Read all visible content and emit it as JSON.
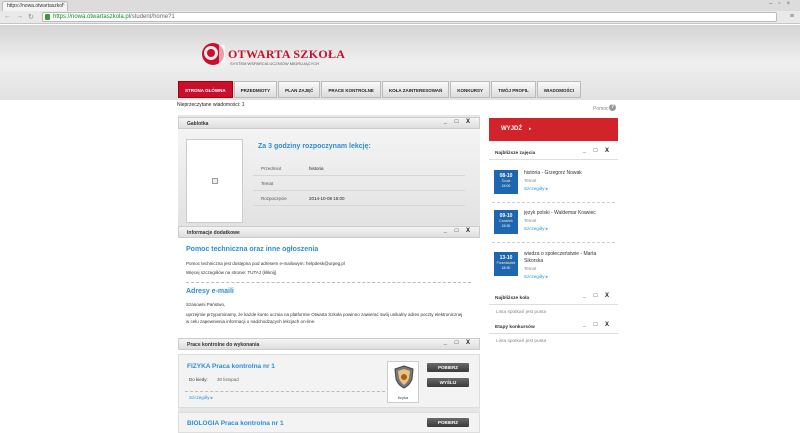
{
  "browser": {
    "tab_title": "https://nowa.otwartaszkol",
    "url_host": "https://nowa.otwartaszkola.pl",
    "url_path": "/student/home?1"
  },
  "logo": {
    "title": "OTWARTA SZKOŁA",
    "subtitle": "SYSTEM WSPARCIA UCZNIÓW MIGRUJĄCYCH"
  },
  "topnav": [
    {
      "label": "STRONA GŁÓWNA",
      "active": true
    },
    {
      "label": "PRZEDMIOTY"
    },
    {
      "label": "PLAN ZAJĘĆ"
    },
    {
      "label": "PRACE KONTROLNE"
    },
    {
      "label": "KOŁA ZAINTERESOWAŃ"
    },
    {
      "label": "KONKURSY"
    },
    {
      "label": "TWÓJ PROFIL"
    },
    {
      "label": "WIADOMOŚCI"
    }
  ],
  "unread_messages": "Nieprzeczytane wiadomości: 1",
  "help_label": "Pomoc",
  "panel_controls": "_ □ X",
  "gablotka": {
    "title": "Gablotka",
    "lesson_heading": "Za 3 godziny rozpoczynam lekcję:",
    "rows": [
      {
        "label": "Przedmiot",
        "value": "historia"
      },
      {
        "label": "Temat",
        "value": ""
      },
      {
        "label": "Rozpoczęcie",
        "value": "2014-10-08 15:00"
      }
    ]
  },
  "info": {
    "title": "Informacje dodatkowe",
    "heading1": "Pomoc techniczna oraz inne ogłoszenia",
    "p1": "Pomoc techniczna jest dostępna pod adresem e-mailowym: helpdesk@orpeg.pl",
    "p2": "Więcej szczegółów na stronie: TUTAJ (kliknij)",
    "heading2": "Adresy e-maili",
    "p3": "Szanowni Państwo,",
    "p4": "uprzejmie przypominamy, że każde konto ucznia na platformie Otwarta Szkoła powinno zawierać swój unikalny adres poczty elektronicznej w celu zapewnienia informacji o nadchodzących lekcjach on-line."
  },
  "tasks": {
    "title": "Prace kontrolne do wykonania",
    "items": [
      {
        "title": "FIZYKA Praca kontrolna nr 1",
        "due_label": "Do kiedy:",
        "due": "30 listopad",
        "more": "Szczegóły ▸",
        "subject": "fizyka",
        "btn_download": "POBIERZ",
        "btn_send": "WYŚLIJ"
      },
      {
        "title": "BIOLOGIA Praca kontrolna nr 1",
        "btn_download": "POBIERZ"
      }
    ]
  },
  "right": {
    "logout": "WYJDŹ",
    "upcoming_title": "Najbliższe zajęcia",
    "lessons": [
      {
        "date": "08-10",
        "day": "Środa",
        "time": "15:00",
        "title": "historia - Grzegorz Nowak",
        "topic": "Temat",
        "more": "Szczegóły ▸"
      },
      {
        "date": "09-10",
        "day": "Czwartek",
        "time": "15:30",
        "title": "język polski - Waldemar Krawiec",
        "topic": "Temat",
        "more": "Szczegóły ▸"
      },
      {
        "date": "13-10",
        "day": "Poniedziałek",
        "time": "18:30",
        "title": "wiedza o społeczeństwie - Marta Sikorska",
        "topic": "Temat",
        "more": "Szczegóły ▸"
      }
    ],
    "clubs_title": "Najbliższe koła",
    "clubs_empty": "Lista spotkań jest pusta",
    "contests_title": "Etapy konkursów",
    "contests_empty": "Lista spotkań jest pusta"
  },
  "colors": {
    "accent_red": "#c8102e",
    "link_blue": "#2a8ed6",
    "date_blue": "#1f66b1"
  }
}
